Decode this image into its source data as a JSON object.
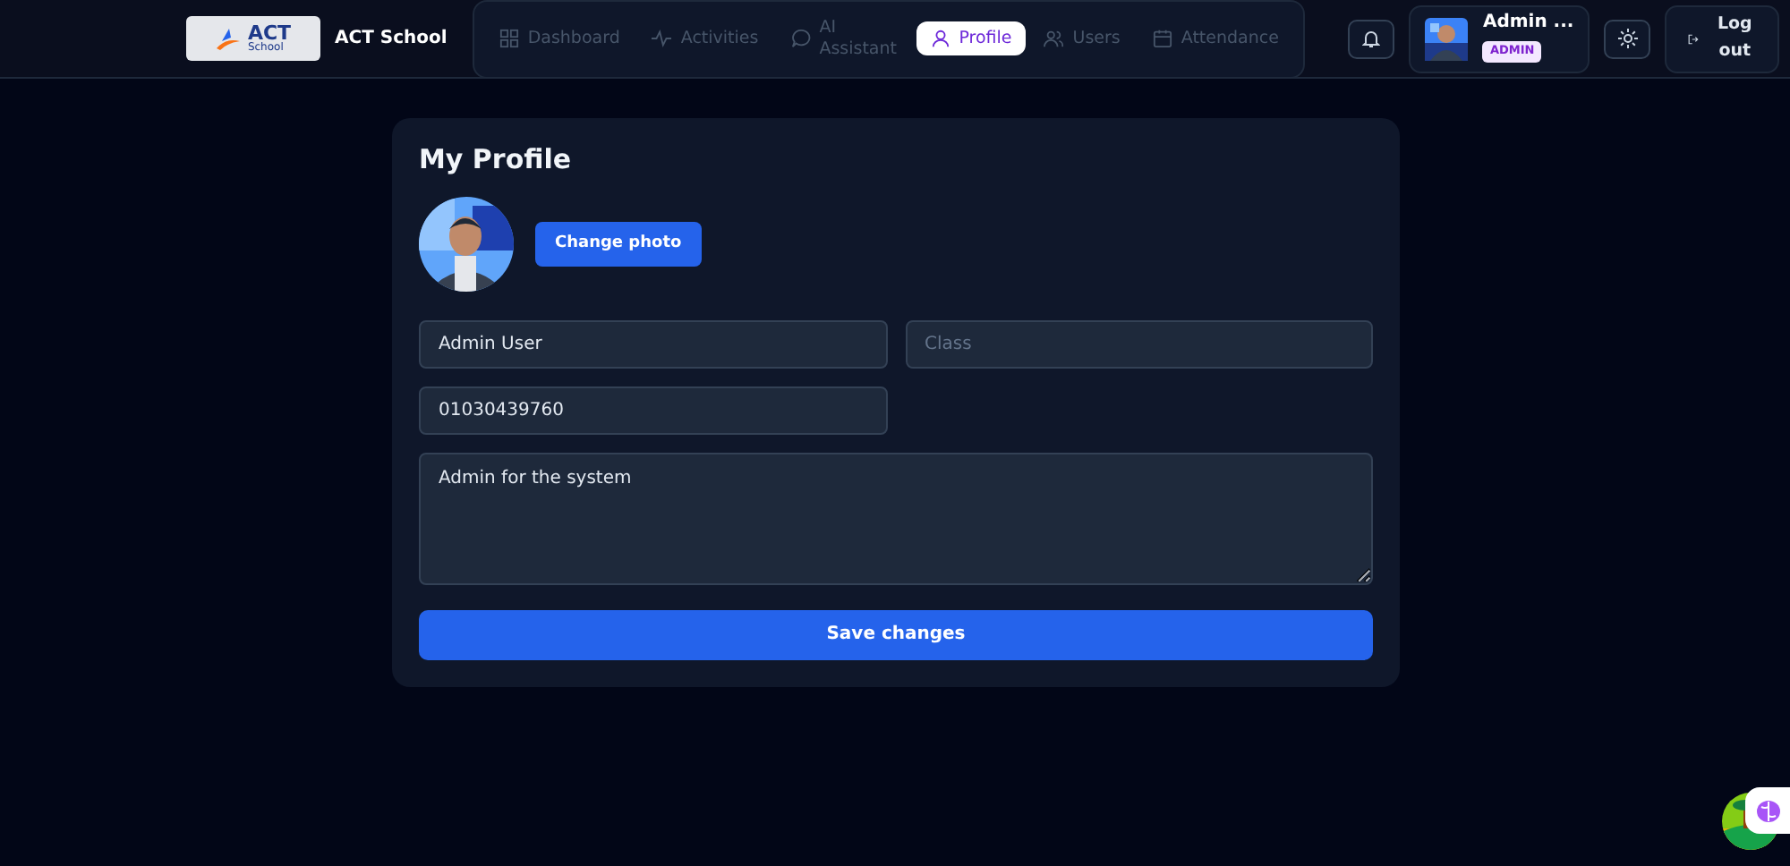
{
  "brand": {
    "logo_text": "ACT",
    "logo_subtext": "School",
    "name": "ACT School"
  },
  "nav": [
    {
      "label": "Dashboard",
      "selected": false
    },
    {
      "label": "Activities",
      "selected": false
    },
    {
      "label": "AI Assistant",
      "selected": false
    },
    {
      "label": "Profile",
      "selected": true
    },
    {
      "label": "Users",
      "selected": false
    },
    {
      "label": "Attendance",
      "selected": false
    }
  ],
  "user": {
    "name": "Admin ...",
    "role": "ADMIN"
  },
  "logout": "Log out",
  "profile": {
    "title": "My Profile",
    "change_photo": "Change photo",
    "fields": [
      {
        "kind": "input",
        "value": "Admin User"
      },
      {
        "kind": "input",
        "placeholder": "Class"
      },
      {
        "kind": "input",
        "value": "01030439760"
      },
      {
        "kind": "textarea",
        "value": "Admin for the system"
      }
    ],
    "save": "Save changes"
  }
}
